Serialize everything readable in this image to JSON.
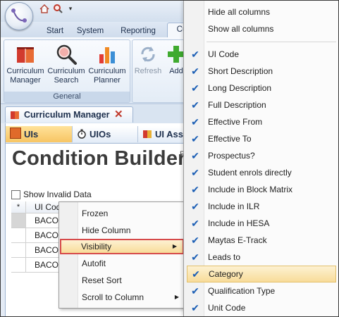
{
  "ribbon": {
    "tabs": [
      "Start",
      "System",
      "Reporting",
      "Cu"
    ],
    "groups": [
      {
        "label": "General",
        "buttons": [
          {
            "label_1": "Curriculum",
            "label_2": "Manager",
            "icon": "curriculum-manager-icon"
          },
          {
            "label_1": "Curriculum",
            "label_2": "Search",
            "icon": "magnifier-icon"
          },
          {
            "label_1": "Curriculum",
            "label_2": "Planner",
            "icon": "bar-chart-icon"
          }
        ]
      }
    ],
    "refresh_label": "Refresh",
    "add_label": "Add"
  },
  "doc_tab": {
    "title": "Curriculum Manager",
    "close": "✕"
  },
  "sub_tabs": [
    "UIs",
    "UIOs",
    "UI Asse"
  ],
  "page": {
    "title": "Condition Builder",
    "side_letter": "R",
    "show_invalid_label": "Show Invalid Data"
  },
  "grid": {
    "header": {
      "marker": "*",
      "col1": "UI Cod"
    },
    "rows": [
      "BACO",
      "BACO",
      "BACO",
      "BACO"
    ]
  },
  "context_menu": {
    "items": [
      {
        "label": "Frozen",
        "submenu": false
      },
      {
        "label": "Hide Column",
        "submenu": false
      },
      {
        "label": "Visibility",
        "submenu": true
      },
      {
        "label": "Autofit",
        "submenu": false
      },
      {
        "label": "Reset Sort",
        "submenu": false
      },
      {
        "label": "Scroll to Column",
        "submenu": true
      }
    ],
    "highlighted": "Visibility"
  },
  "column_menu": {
    "actions": [
      "Hide all columns",
      "Show all columns"
    ],
    "columns": [
      {
        "label": "UI Code",
        "checked": true
      },
      {
        "label": "Short Description",
        "checked": true
      },
      {
        "label": "Long Description",
        "checked": true
      },
      {
        "label": "Full Description",
        "checked": true
      },
      {
        "label": "Effective From",
        "checked": true
      },
      {
        "label": "Effective To",
        "checked": true
      },
      {
        "label": "Prospectus?",
        "checked": true
      },
      {
        "label": "Student enrols directly",
        "checked": true
      },
      {
        "label": "Include in Block Matrix",
        "checked": true
      },
      {
        "label": "Include in ILR",
        "checked": true
      },
      {
        "label": "Include in HESA",
        "checked": true
      },
      {
        "label": "Maytas E-Track",
        "checked": true
      },
      {
        "label": "Leads to",
        "checked": true
      },
      {
        "label": "Category",
        "checked": true
      },
      {
        "label": "Qualification Type",
        "checked": true
      },
      {
        "label": "Unit Code",
        "checked": true
      }
    ],
    "highlighted": "Category"
  },
  "colors": {
    "tick": "#1c5fb5",
    "highlight": "#f8dc99",
    "highlight_border_red": "#d64a4a"
  }
}
